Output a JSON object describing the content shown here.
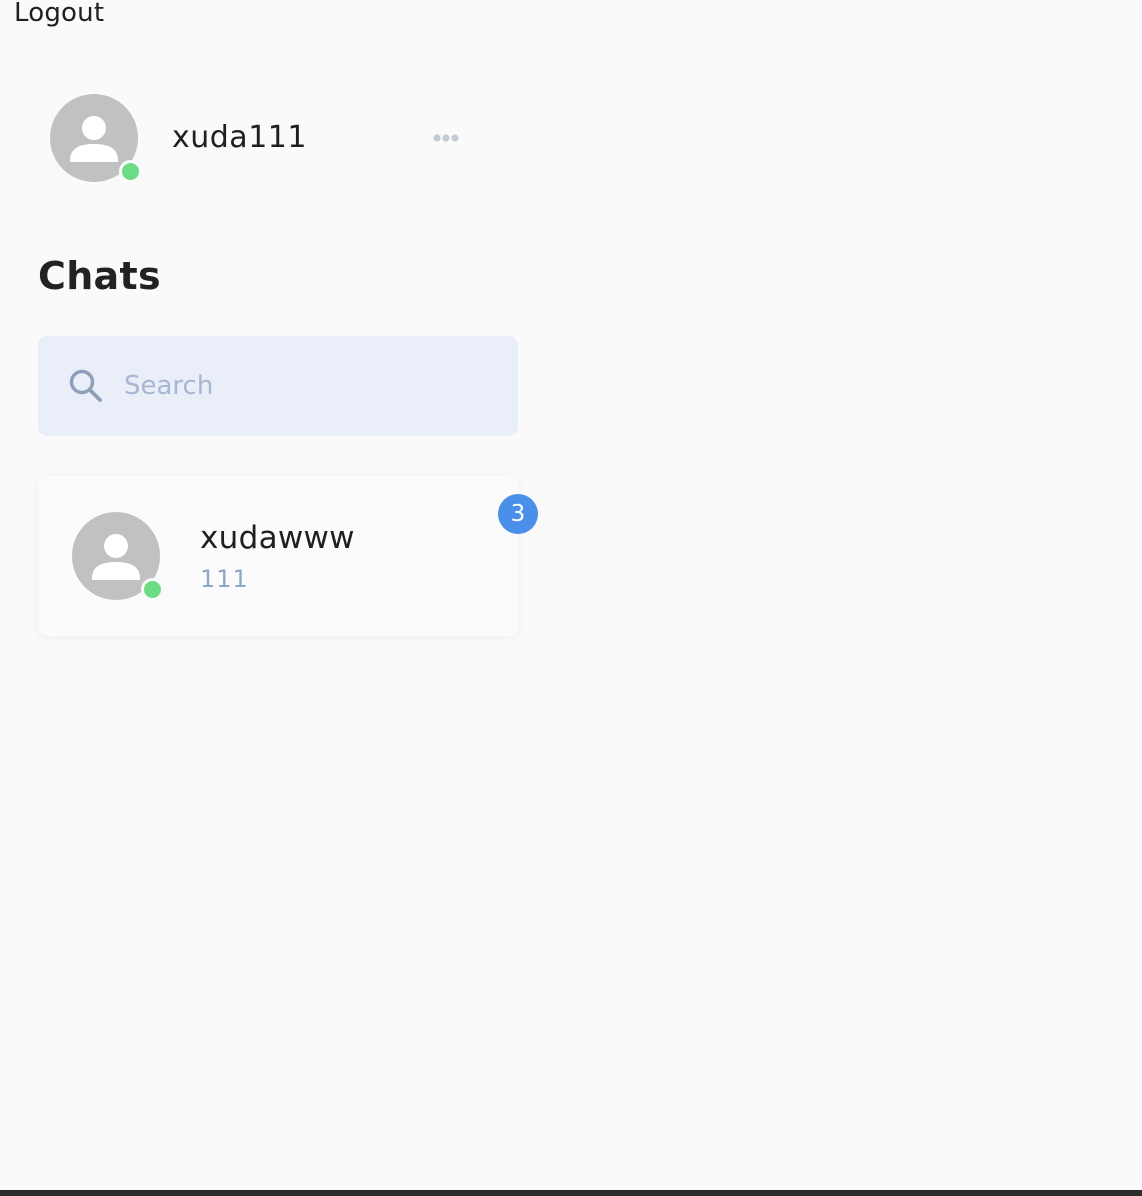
{
  "header": {
    "logout_label": "Logout"
  },
  "profile": {
    "username": "xuda111",
    "status": "online",
    "avatar_icon": "user-avatar-icon",
    "more_icon": "more-horizontal-icon"
  },
  "chats": {
    "title": "Chats",
    "search": {
      "placeholder": "Search",
      "value": "",
      "icon": "search-icon"
    },
    "items": [
      {
        "name": "xudawww",
        "preview": "111",
        "unread_count": "3",
        "status": "online",
        "avatar_icon": "user-avatar-icon"
      }
    ]
  },
  "colors": {
    "background": "#fafafa",
    "online": "#6bdc83",
    "badge": "#4a90ea",
    "search_bg": "#e9eef8",
    "avatar": "#c1c1c1",
    "muted_text": "#8ea6c6"
  }
}
